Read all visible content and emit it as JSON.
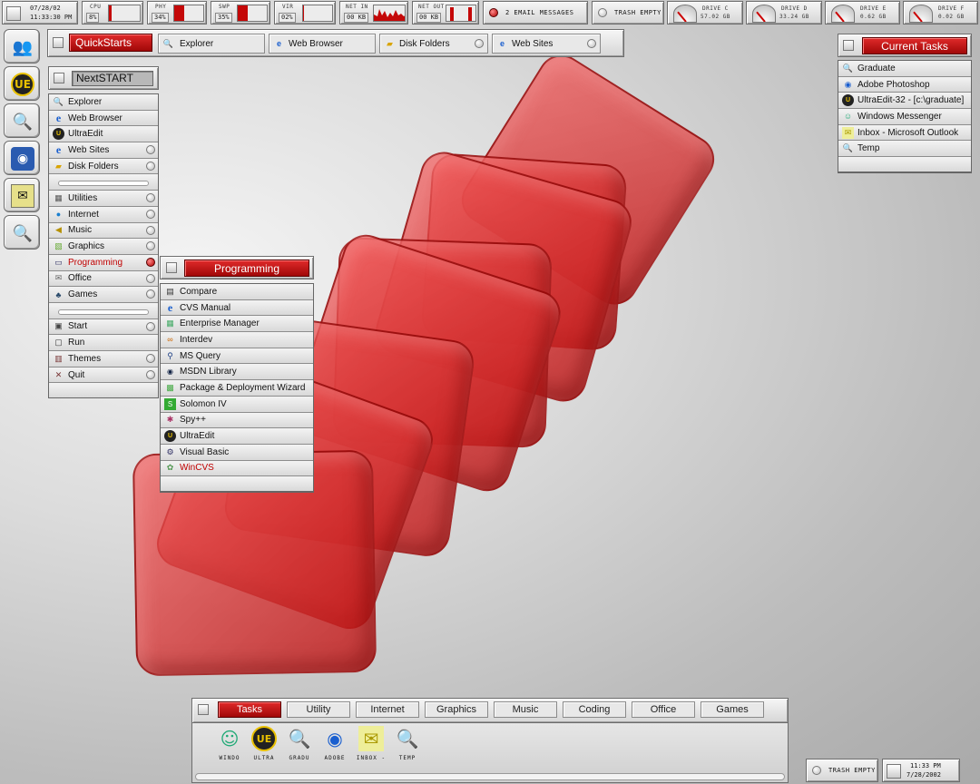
{
  "colors": {
    "accent": "#c40808",
    "panel": "#d8d8d8"
  },
  "topbar": {
    "clock": {
      "date": "07/28/02",
      "time": "11:33:30 PM"
    },
    "cpu": {
      "label": "CPU",
      "value": "8%",
      "level": 0.08
    },
    "phy": {
      "label": "PHY",
      "value": "34%",
      "level": 0.34
    },
    "swp": {
      "label": "SWP",
      "value": "35%",
      "level": 0.35
    },
    "vir": {
      "label": "VIR",
      "value": "02%",
      "level": 0.02
    },
    "net_in": {
      "label": "NET IN",
      "value": "00 KB"
    },
    "net_out": {
      "label": "NET OUT",
      "value": "00 KB"
    },
    "email": "2 EMAIL MESSAGES",
    "trash": "TRASH EMPTY",
    "drives": [
      {
        "label": "DRIVE C",
        "value": "57.02 GB"
      },
      {
        "label": "DRIVE D",
        "value": "33.24 GB"
      },
      {
        "label": "DRIVE E",
        "value": "0.62 GB"
      },
      {
        "label": "DRIVE F",
        "value": "0.02 GB"
      }
    ]
  },
  "quickstarts": {
    "title": "QuickStarts",
    "tabs": [
      {
        "label": "Explorer",
        "icon": "explorer-icon"
      },
      {
        "label": "Web Browser",
        "icon": "ie-icon"
      },
      {
        "label": "Disk Folders",
        "icon": "folder-icon"
      },
      {
        "label": "Web Sites",
        "icon": "ie-icon"
      }
    ]
  },
  "nextstart": {
    "title": "NextSTART",
    "items": [
      {
        "label": "Explorer",
        "icon": "explorer-icon"
      },
      {
        "label": "Web Browser",
        "icon": "ie-icon"
      },
      {
        "label": "UltraEdit",
        "icon": "ultraedit-icon"
      },
      {
        "label": "Web Sites",
        "icon": "ie-icon",
        "sub": true
      },
      {
        "label": "Disk Folders",
        "icon": "folder-icon",
        "sub": true
      },
      {
        "sep": true
      },
      {
        "label": "Utilities",
        "icon": "utilities-icon",
        "sub": true
      },
      {
        "label": "Internet",
        "icon": "globe-icon",
        "sub": true
      },
      {
        "label": "Music",
        "icon": "speaker-icon",
        "sub": true
      },
      {
        "label": "Graphics",
        "icon": "graphics-icon",
        "sub": true
      },
      {
        "label": "Programming",
        "icon": "window-icon",
        "sub": true,
        "selected": true
      },
      {
        "label": "Office",
        "icon": "mail-icon",
        "sub": true
      },
      {
        "label": "Games",
        "icon": "games-icon",
        "sub": true
      },
      {
        "sep": true
      },
      {
        "label": "Start",
        "icon": "start-icon",
        "sub": true
      },
      {
        "label": "Run",
        "icon": "run-icon"
      },
      {
        "label": "Themes",
        "icon": "themes-icon",
        "sub": true
      },
      {
        "label": "Quit",
        "icon": "quit-icon",
        "sub": true
      }
    ]
  },
  "programming": {
    "title": "Programming",
    "items": [
      {
        "label": "Compare",
        "icon": "compare-icon"
      },
      {
        "label": "CVS Manual",
        "icon": "ie-icon"
      },
      {
        "label": "Enterprise Manager",
        "icon": "enterprise-icon"
      },
      {
        "label": "Interdev",
        "icon": "interdev-icon"
      },
      {
        "label": "MS Query",
        "icon": "query-icon"
      },
      {
        "label": "MSDN Library",
        "icon": "msdn-icon"
      },
      {
        "label": "Package & Deployment Wizard",
        "icon": "package-icon"
      },
      {
        "label": "Solomon IV",
        "icon": "solomon-icon"
      },
      {
        "label": "Spy++",
        "icon": "spy-icon"
      },
      {
        "label": "UltraEdit",
        "icon": "ultraedit-icon"
      },
      {
        "label": "Visual Basic",
        "icon": "vb-icon"
      },
      {
        "label": "WinCVS",
        "icon": "wincvs-icon",
        "selected": true
      }
    ]
  },
  "current_tasks": {
    "title": "Current Tasks",
    "items": [
      {
        "label": "Graduate",
        "icon": "explorer-icon"
      },
      {
        "label": "Adobe Photoshop",
        "icon": "photoshop-icon"
      },
      {
        "label": "UltraEdit-32 - [c:\\graduate]",
        "icon": "ultraedit-icon"
      },
      {
        "label": "Windows Messenger",
        "icon": "messenger-icon"
      },
      {
        "label": "Inbox - Microsoft Outlook",
        "icon": "outlook-icon"
      },
      {
        "label": "Temp",
        "icon": "explorer-icon"
      }
    ]
  },
  "bottom": {
    "tabs": [
      "Tasks",
      "Utility",
      "Internet",
      "Graphics",
      "Music",
      "Coding",
      "Office",
      "Games"
    ],
    "active_tab": "Tasks",
    "tasks": [
      {
        "label": "WINDO",
        "icon": "messenger-icon"
      },
      {
        "label": "ULTRA",
        "icon": "ultraedit-icon"
      },
      {
        "label": "GRADU",
        "icon": "explorer-icon"
      },
      {
        "label": "ADOBE",
        "icon": "photoshop-icon"
      },
      {
        "label": "INBOX -",
        "icon": "outlook-icon"
      },
      {
        "label": "TEMP",
        "icon": "explorer-icon"
      }
    ],
    "trash": "TRASH EMPTY",
    "clock": {
      "time": "11:33 PM",
      "date": "7/28/2002"
    }
  }
}
